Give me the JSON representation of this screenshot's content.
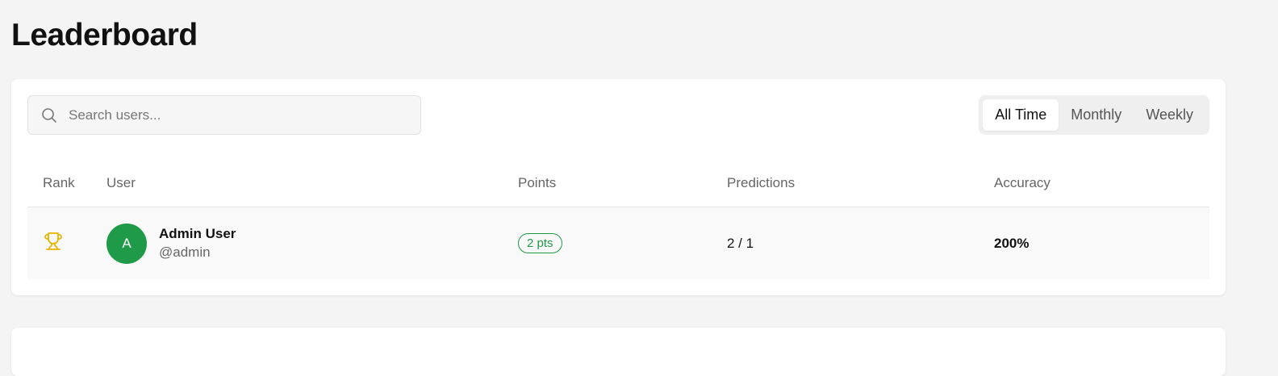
{
  "page": {
    "title": "Leaderboard"
  },
  "search": {
    "placeholder": "Search users..."
  },
  "tabs": [
    {
      "label": "All Time",
      "active": true
    },
    {
      "label": "Monthly",
      "active": false
    },
    {
      "label": "Weekly",
      "active": false
    }
  ],
  "table": {
    "headers": {
      "rank": "Rank",
      "user": "User",
      "points": "Points",
      "predictions": "Predictions",
      "accuracy": "Accuracy"
    },
    "rows": [
      {
        "rank_icon": "trophy-icon",
        "avatar_initial": "A",
        "name": "Admin User",
        "handle": "@admin",
        "points": "2 pts",
        "predictions": "2 / 1",
        "accuracy": "200%"
      }
    ]
  },
  "colors": {
    "accent_green": "#1f9a49",
    "trophy_gold": "#e8b400"
  }
}
